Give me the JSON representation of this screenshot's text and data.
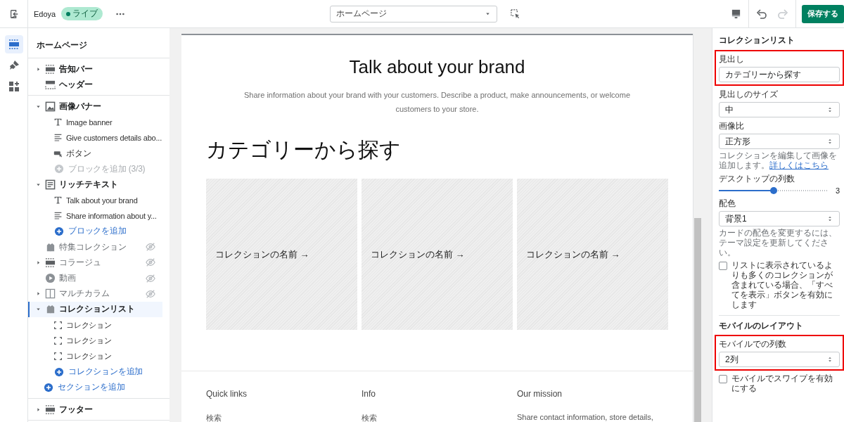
{
  "topbar": {
    "store_name": "Edoya",
    "status": "ライブ",
    "page_select": "ホームページ",
    "save_button": "保存する"
  },
  "sidebar": {
    "title": "ホームページ",
    "groups": [
      [
        {
          "label": "告知バー",
          "kind": "bar",
          "expanded": false
        },
        {
          "label": "ヘッダー",
          "kind": "header"
        }
      ],
      [
        {
          "label": "画像バナー",
          "kind": "image",
          "expanded": true,
          "children": [
            {
              "kind": "text",
              "label": "Image banner"
            },
            {
              "kind": "lines",
              "label": "Give customers details abo..."
            },
            {
              "kind": "button",
              "label": "ボタン"
            },
            {
              "kind": "add",
              "label": "ブロックを追加 (3/3)",
              "disabled": true
            }
          ]
        },
        {
          "label": "リッチテキスト",
          "kind": "doc",
          "expanded": true,
          "children": [
            {
              "kind": "text",
              "label": "Talk about your brand"
            },
            {
              "kind": "lines",
              "label": "Share information about y..."
            },
            {
              "kind": "add",
              "label": "ブロックを追加",
              "disabled": false
            }
          ]
        },
        {
          "label": "特集コレクション",
          "kind": "tag",
          "hidden": true
        },
        {
          "label": "コラージュ",
          "kind": "bar",
          "expanded": false,
          "hidden": true
        },
        {
          "label": "動画",
          "kind": "play",
          "hidden": true
        },
        {
          "label": "マルチカラム",
          "kind": "columns",
          "expanded": false,
          "hidden": true
        },
        {
          "label": "コレクションリスト",
          "kind": "tag",
          "expanded": true,
          "selected": true,
          "children": [
            {
              "kind": "frame",
              "label": "コレクション"
            },
            {
              "kind": "frame",
              "label": "コレクション"
            },
            {
              "kind": "frame",
              "label": "コレクション"
            },
            {
              "kind": "add",
              "label": "コレクションを追加",
              "disabled": false
            }
          ]
        },
        {
          "kind": "add",
          "label": "セクションを追加",
          "disabled": false
        }
      ],
      [
        {
          "label": "フッター",
          "kind": "bar",
          "expanded": false
        }
      ]
    ]
  },
  "preview": {
    "heading": "Talk about your brand",
    "body": "Share information about your brand with your customers. Describe a product, make announcements, or welcome customers to your store.",
    "collection_title": "カテゴリーから探す",
    "cards": [
      {
        "label": "コレクションの名前 →"
      },
      {
        "label": "コレクションの名前 →"
      },
      {
        "label": "コレクションの名前 →"
      }
    ],
    "footer": [
      {
        "heading": "Quick links",
        "text": "検索"
      },
      {
        "heading": "Info",
        "text": "検索"
      },
      {
        "heading": "Our mission",
        "text": "Share contact information, store details,"
      }
    ]
  },
  "settings": {
    "title": "コレクションリスト",
    "fields": [
      {
        "kind": "text",
        "label": "見出し",
        "value": "カテゴリーから探す",
        "highlighted": true
      },
      {
        "kind": "select",
        "label": "見出しのサイズ",
        "value": "中"
      },
      {
        "kind": "select",
        "label": "画像比",
        "value": "正方形",
        "help": "コレクションを編集して画像を追加します。",
        "help_link": "詳しくはこちら"
      },
      {
        "kind": "slider",
        "label": "デスクトップの列数",
        "level": 0.5,
        "reading": "3"
      },
      {
        "kind": "select",
        "label": "配色",
        "value": "背景1",
        "help": "カードの配色を変更するには、テーマ設定を更新してください。"
      },
      {
        "kind": "checkbox",
        "label": "リストに表示されているよりも多くのコレクションが含まれている場合、「すべてを表示」ボタンを有効にします",
        "checked": false
      },
      {
        "kind": "heading",
        "label": "モバイルのレイアウト"
      },
      {
        "kind": "select",
        "label": "モバイルでの列数",
        "value": "2列",
        "highlighted": true
      },
      {
        "kind": "checkbox",
        "label": "モバイルでスワイプを有効にする",
        "checked": false
      }
    ]
  }
}
